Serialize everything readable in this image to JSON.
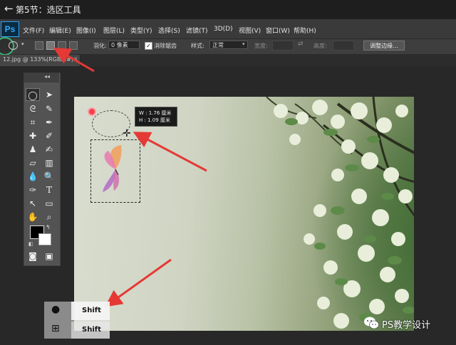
{
  "titlebar": {
    "title": "第5节：选区工具"
  },
  "menu": {
    "app": "Ps",
    "items": [
      "文件(F)",
      "编辑(E)",
      "图像(I)",
      "图层(L)",
      "类型(Y)",
      "选择(S)",
      "滤镜(T)",
      "3D(D)",
      "视图(V)",
      "窗口(W)",
      "帮助(H)"
    ]
  },
  "options": {
    "feather_label": "羽化:",
    "feather_value": "0 像素",
    "antialias_label": "消除锯齿",
    "antialias_checked": true,
    "style_label": "样式:",
    "style_value": "正常",
    "width_label": "宽度:",
    "height_label": "高度:",
    "refine_edge": "调整边缘..."
  },
  "document": {
    "tab": "12.jpg @ 133%(RGB/8#)",
    "close": "×"
  },
  "tooltip": {
    "w": "W :  1.76 厘米",
    "h": "H :  1.09 厘米"
  },
  "tools_panel": {
    "collapse": "◂◂"
  },
  "keys": {
    "mac_label": "Shift",
    "win_label": "Shift"
  },
  "watermark": {
    "text": "PS教学设计"
  },
  "colors": {
    "accent_arrow": "#e53935",
    "ps_blue": "#31a8ff"
  }
}
